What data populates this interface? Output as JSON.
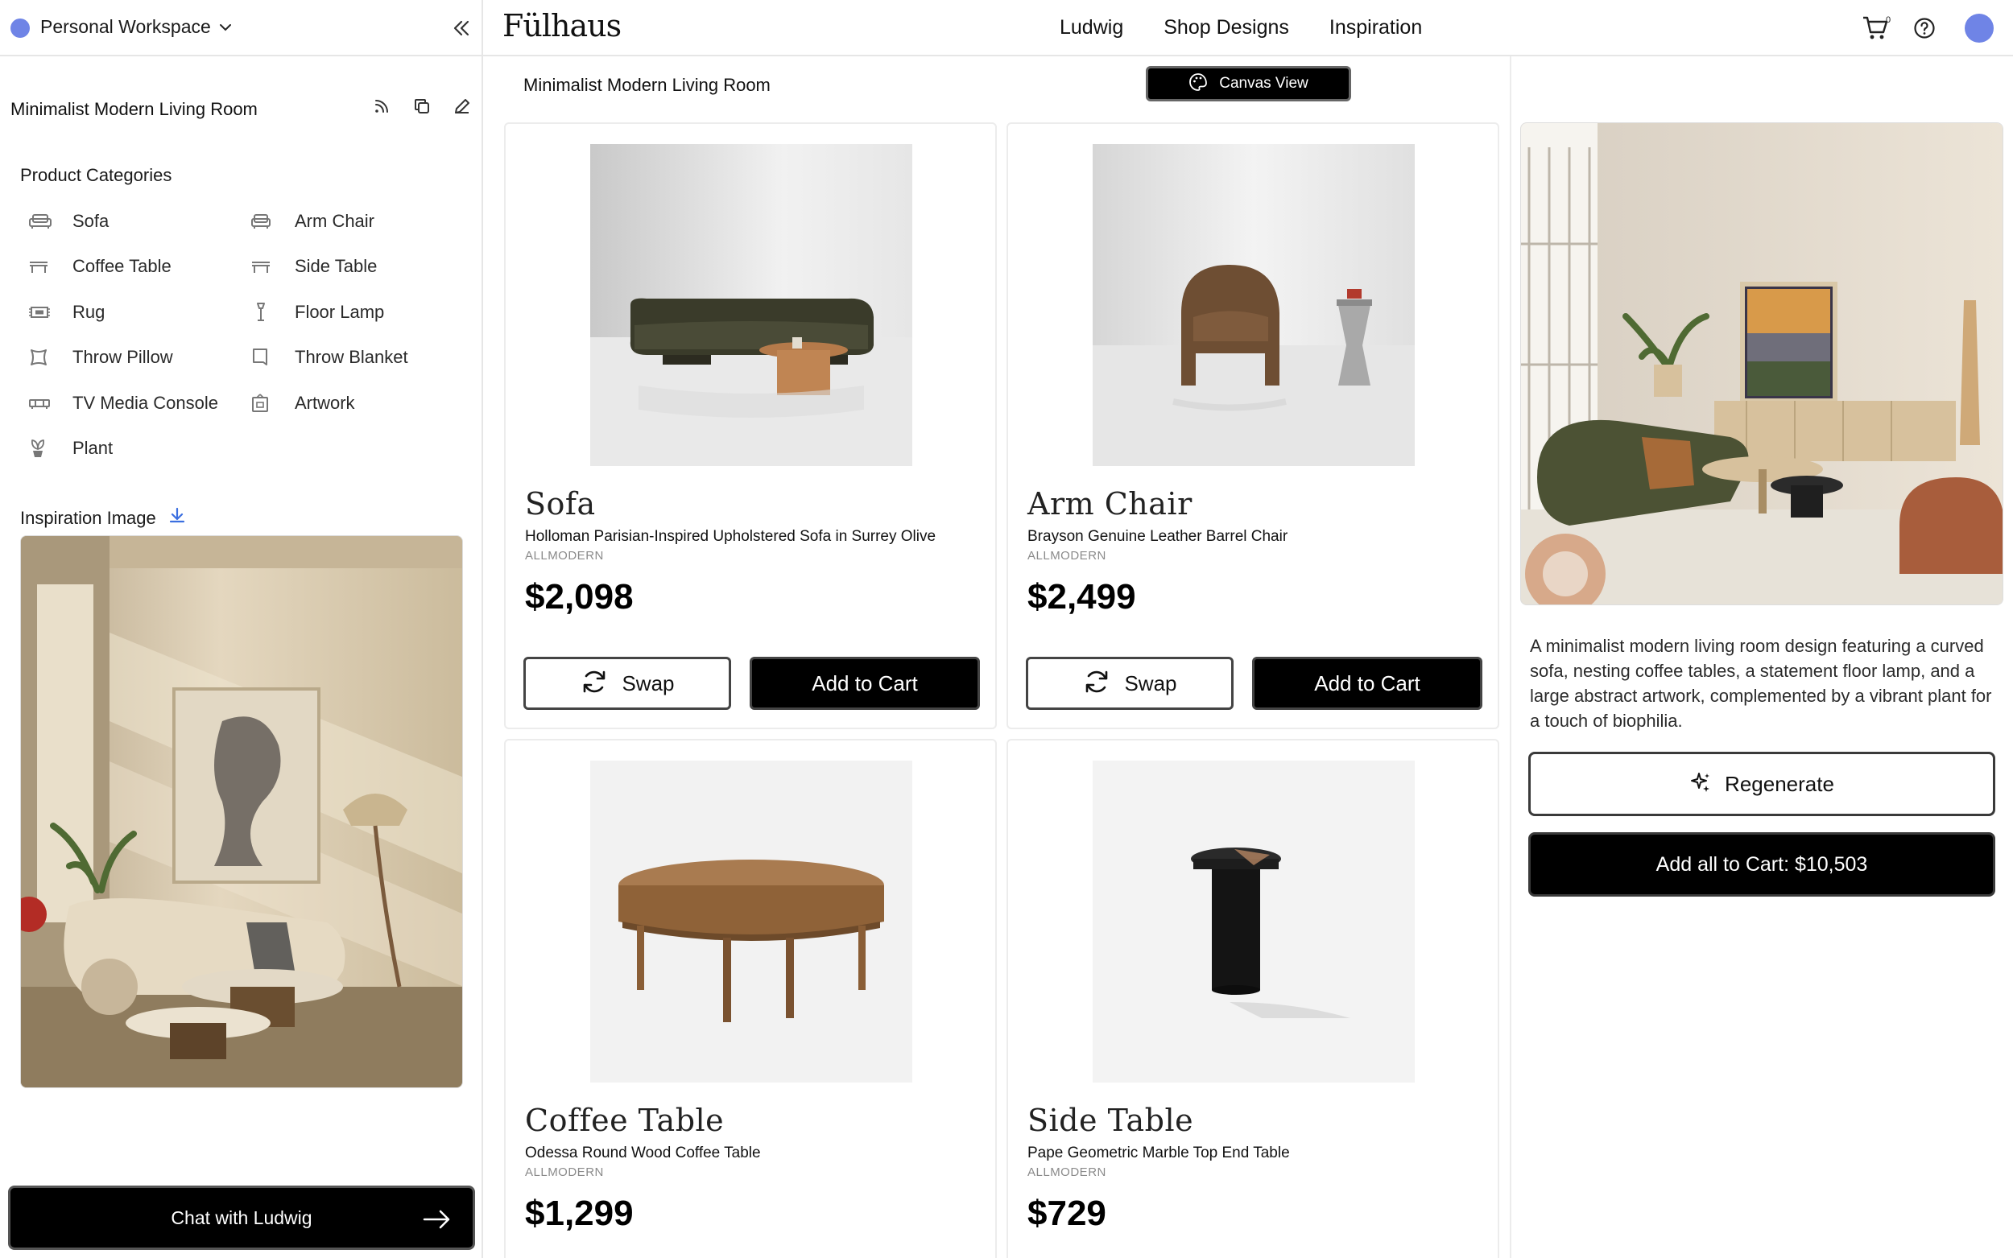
{
  "workspace": {
    "name": "Personal Workspace",
    "dot_color": "#6f84e6"
  },
  "project": {
    "title": "Minimalist Modern Living Room"
  },
  "sidebar": {
    "categories_title": "Product Categories",
    "categories": [
      {
        "label": "Sofa",
        "icon": "sofa-icon"
      },
      {
        "label": "Arm Chair",
        "icon": "armchair-icon"
      },
      {
        "label": "Coffee Table",
        "icon": "coffee-table-icon"
      },
      {
        "label": "Side Table",
        "icon": "side-table-icon"
      },
      {
        "label": "Rug",
        "icon": "rug-icon"
      },
      {
        "label": "Floor Lamp",
        "icon": "floor-lamp-icon"
      },
      {
        "label": "Throw Pillow",
        "icon": "pillow-icon"
      },
      {
        "label": "Throw Blanket",
        "icon": "blanket-icon"
      },
      {
        "label": "TV Media Console",
        "icon": "console-icon"
      },
      {
        "label": "Artwork",
        "icon": "artwork-icon"
      },
      {
        "label": "Plant",
        "icon": "plant-icon"
      }
    ],
    "inspiration_label": "Inspiration Image",
    "chat_button": "Chat with Ludwig"
  },
  "header": {
    "logo": "Fülhaus",
    "nav": [
      "Ludwig",
      "Shop Designs",
      "Inspiration"
    ],
    "cart_count": "0",
    "avatar_color": "#6f84e6"
  },
  "main": {
    "title": "Minimalist Modern Living Room",
    "canvas_button": "Canvas View",
    "swap_label": "Swap",
    "add_label": "Add to Cart",
    "products": [
      {
        "type": "Sofa",
        "name": "Holloman Parisian-Inspired Upholstered Sofa in Surrey Olive",
        "brand": "ALLMODERN",
        "price": "$2,098"
      },
      {
        "type": "Arm Chair",
        "name": "Brayson Genuine Leather Barrel Chair",
        "brand": "ALLMODERN",
        "price": "$2,499"
      },
      {
        "type": "Coffee Table",
        "name": "Odessa Round Wood Coffee Table",
        "brand": "ALLMODERN",
        "price": "$1,299"
      },
      {
        "type": "Side Table",
        "name": "Pape Geometric Marble Top End Table",
        "brand": "ALLMODERN",
        "price": "$729"
      }
    ]
  },
  "right_panel": {
    "description": "A minimalist modern living room design featuring a curved sofa, nesting coffee tables, a statement floor lamp, and a large abstract artwork, complemented by a vibrant plant for a touch of biophilia.",
    "regenerate": "Regenerate",
    "add_all": "Add all to Cart: $10,503"
  }
}
